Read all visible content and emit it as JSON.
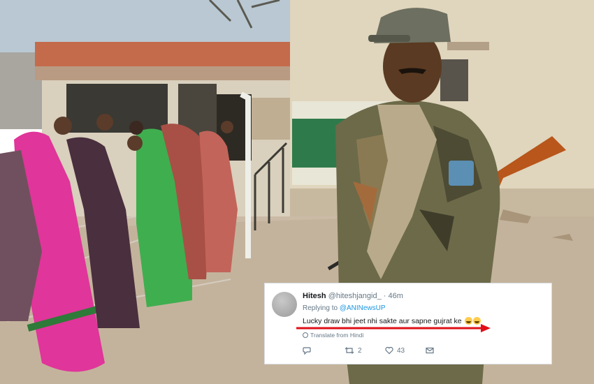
{
  "tweet": {
    "display_name": "Hitesh",
    "handle": "@hiteshjangid_",
    "separator": "·",
    "time": "46m",
    "replying_prefix": "Replying to",
    "replying_to": "@ANINewsUP",
    "text": "Lucky draw bhi jeet nhi sakte aur sapne gujrat ke",
    "translate": "Translate from Hindi",
    "retweets": "2",
    "likes": "43",
    "emoji": "tears-of-joy-emoji"
  },
  "colors": {
    "underline_arrow": "#e0101a",
    "mention": "#1b95e0",
    "sign_green": "#2f7a4a"
  }
}
